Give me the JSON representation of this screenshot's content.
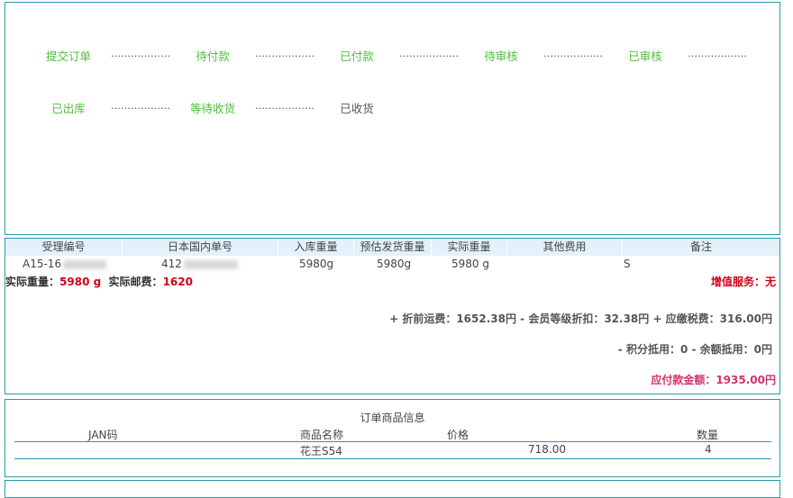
{
  "status": {
    "steps": [
      {
        "label": "提交订单",
        "state": "active"
      },
      {
        "label": "待付款",
        "state": "active"
      },
      {
        "label": "已付款",
        "state": "active"
      },
      {
        "label": "待审核",
        "state": "active"
      },
      {
        "label": "已审核",
        "state": "active"
      },
      {
        "label": "已出库",
        "state": "active"
      },
      {
        "label": "等待收货",
        "state": "active"
      },
      {
        "label": "已收货",
        "state": "current"
      }
    ],
    "separator": "………………",
    "colors": {
      "step": "#4cbf3a",
      "current": "#555555"
    }
  },
  "weights": {
    "headers": [
      "受理编号",
      "日本国内单号",
      "入库重量",
      "预估发货重量",
      "实际重量",
      "其他费用",
      "备注"
    ],
    "row": {
      "accept_no": "A15-16",
      "domestic_no": "412",
      "in_weight": "5980g",
      "est_weight": "5980g",
      "actual_weight": "5980 g",
      "other_fee": "",
      "note": "S"
    },
    "summary": {
      "actual_weight_label": "实际重量：",
      "actual_weight_value": "5980 g",
      "actual_postage_label": "实际邮费：",
      "actual_postage_value": "1620",
      "value_added": "增值服务：无"
    },
    "fees_line1": "+ 折前运费：1652.38円 - 会员等级折扣：32.38円 + 应缴税费：316.00円",
    "fees_line2": "- 积分抵用：0 - 余额抵用：0円",
    "total": "应付款金额：1935.00円"
  },
  "items": {
    "title": "订单商品信息",
    "headers": [
      "JAN码",
      "商品名称",
      "价格",
      "数量"
    ],
    "rows": [
      {
        "jan": "",
        "name": "花王S54",
        "price": "718.00",
        "qty": "4"
      }
    ]
  }
}
